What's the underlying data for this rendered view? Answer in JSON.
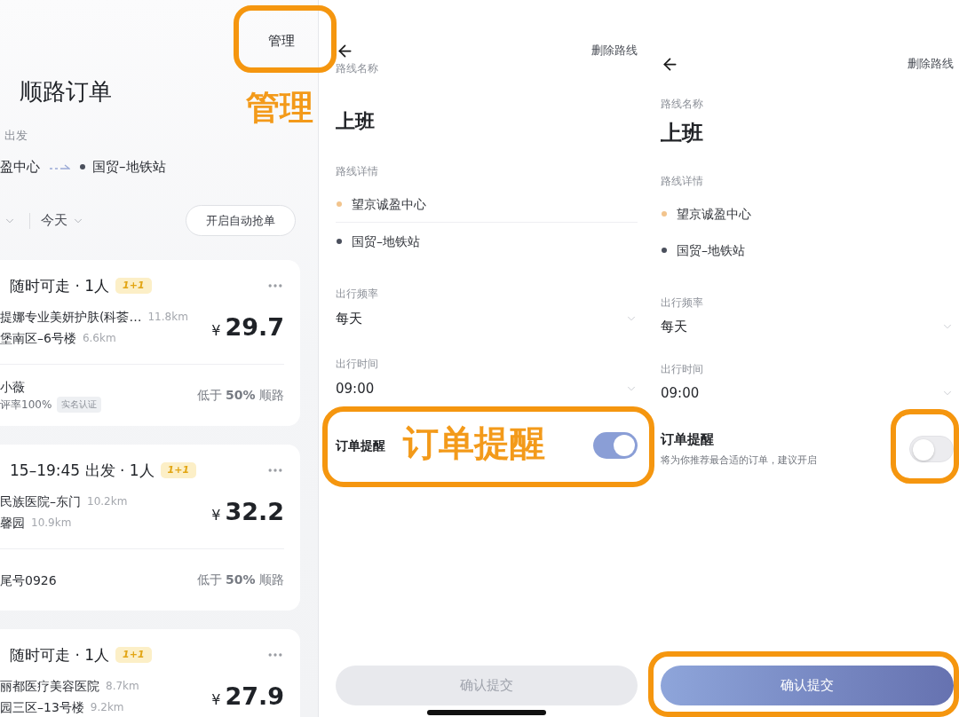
{
  "order_list": {
    "manage_link": "管理",
    "title": "顺路订单",
    "route": {
      "departure": "出发",
      "from": "盈中心",
      "to": {
        "name": "国贸–地铁站",
        "color": "#4a4f5c"
      }
    },
    "filters": [
      {
        "label": "今天"
      }
    ],
    "auto_grab_button": "开启自动抢单",
    "orders": [
      {
        "time": "随时可走 · 1人",
        "badge": "1+1",
        "stops": [
          {
            "place": "提娜专业美妍护肤(科荟…",
            "distance": "11.8km"
          },
          {
            "place": "堡南区–6号楼",
            "distance": "6.6km"
          }
        ],
        "currency": "¥",
        "price": "29.7",
        "passenger": "小薇",
        "rating": "评率100%",
        "verified_badge": "实名认证",
        "match": "低于 **50%** 顺路"
      },
      {
        "time": "15–19:45 出发 · 1人",
        "badge": "1+1",
        "stops": [
          {
            "place": "民族医院–东门",
            "distance": "10.2km"
          },
          {
            "place": "馨园",
            "distance": "10.9km"
          }
        ],
        "currency": "¥",
        "price": "32.2",
        "passenger": "尾号0926",
        "match": "低于 **50%** 顺路"
      },
      {
        "time": "随时可走 · 1人",
        "badge": "1+1",
        "stops": [
          {
            "place": "丽都医疗美容医院",
            "distance": "8.7km"
          },
          {
            "place": "园三区–13号楼",
            "distance": "9.2km"
          }
        ],
        "currency": "¥",
        "price": "27.9"
      }
    ]
  },
  "route_editors": [
    {
      "delete_link": "删除路线",
      "name_label": "路线名称",
      "name": "上班",
      "details_label": "路线详情",
      "stops": [
        {
          "name": "望京诚盈中心",
          "color": "#f2c48d"
        },
        {
          "name": "国贸–地铁站",
          "color": "#4a4f5c"
        }
      ],
      "fields": [
        {
          "label": "出行频率",
          "value": "每天"
        },
        {
          "label": "出行时间",
          "value": "09:00"
        }
      ],
      "reminder": {
        "label": "订单提醒",
        "on": true
      },
      "submit": {
        "label": "确认提交",
        "disabled": true
      }
    },
    {
      "delete_link": "删除路线",
      "name_label": "路线名称",
      "name": "上班",
      "details_label": "路线详情",
      "stops": [
        {
          "name": "望京诚盈中心",
          "color": "#f2c48d"
        },
        {
          "name": "国贸–地铁站",
          "color": "#4a4f5c"
        }
      ],
      "fields": [
        {
          "label": "出行频率",
          "value": "每天"
        },
        {
          "label": "出行时间",
          "value": "09:00"
        }
      ],
      "reminder": {
        "label": "订单提醒",
        "description": "将为你推荐最合适的订单，建议开启",
        "on": false
      },
      "submit": {
        "label": "确认提交",
        "disabled": false
      }
    }
  ],
  "annotations": [
    {
      "text": "管理"
    },
    {
      "text": "订单提醒"
    }
  ]
}
